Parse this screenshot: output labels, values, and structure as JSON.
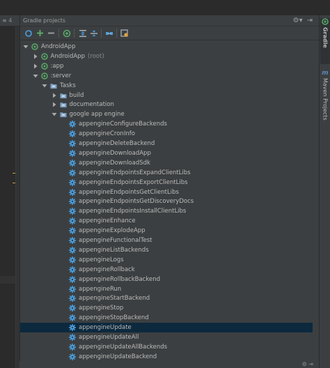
{
  "editor": {
    "tab_marker": "≡ 4"
  },
  "panel": {
    "title": "Gradle projects",
    "title_icons": [
      "gear-icon",
      "close-icon"
    ]
  },
  "toolbar": {
    "buttons": [
      "refresh-icon",
      "add-icon",
      "remove-icon",
      "execute-icon",
      "expand-all-icon",
      "collapse-all-icon",
      "link-icon",
      "settings-icon"
    ]
  },
  "tree": [
    {
      "label": "AndroidApp",
      "expanded": true,
      "icon": "gradle-icon"
    },
    {
      "label": "AndroidApp",
      "suffix": "(root)",
      "expanded": false,
      "icon": "gradle-icon"
    },
    {
      "label": ":app",
      "expanded": false,
      "icon": "gradle-icon"
    },
    {
      "label": ":server",
      "expanded": true,
      "icon": "gradle-icon"
    },
    {
      "label": "Tasks",
      "expanded": true,
      "icon": "folder-icon"
    },
    {
      "label": "build",
      "expanded": false,
      "icon": "folder-icon"
    },
    {
      "label": "documentation",
      "expanded": false,
      "icon": "folder-icon"
    },
    {
      "label": "google app engine",
      "expanded": true,
      "icon": "folder-icon"
    },
    {
      "label": "appengineConfigureBackends",
      "icon": "task-gear-icon"
    },
    {
      "label": "appengineCronInfo",
      "icon": "task-gear-icon"
    },
    {
      "label": "appengineDeleteBackend",
      "icon": "task-gear-icon"
    },
    {
      "label": "appengineDownloadApp",
      "icon": "task-gear-icon"
    },
    {
      "label": "appengineDownloadSdk",
      "icon": "task-gear-icon"
    },
    {
      "label": "appengineEndpointsExpandClientLibs",
      "icon": "task-gear-icon"
    },
    {
      "label": "appengineEndpointsExportClientLibs",
      "icon": "task-gear-icon"
    },
    {
      "label": "appengineEndpointsGetClientLibs",
      "icon": "task-gear-icon"
    },
    {
      "label": "appengineEndpointsGetDiscoveryDocs",
      "icon": "task-gear-icon"
    },
    {
      "label": "appengineEndpointsInstallClientLibs",
      "icon": "task-gear-icon"
    },
    {
      "label": "appengineEnhance",
      "icon": "task-gear-icon"
    },
    {
      "label": "appengineExplodeApp",
      "icon": "task-gear-icon"
    },
    {
      "label": "appengineFunctionalTest",
      "icon": "task-gear-icon"
    },
    {
      "label": "appengineListBackends",
      "icon": "task-gear-icon"
    },
    {
      "label": "appengineLogs",
      "icon": "task-gear-icon"
    },
    {
      "label": "appengineRollback",
      "icon": "task-gear-icon"
    },
    {
      "label": "appengineRollbackBackend",
      "icon": "task-gear-icon"
    },
    {
      "label": "appengineRun",
      "icon": "task-gear-icon"
    },
    {
      "label": "appengineStartBackend",
      "icon": "task-gear-icon"
    },
    {
      "label": "appengineStop",
      "icon": "task-gear-icon"
    },
    {
      "label": "appengineStopBackend",
      "icon": "task-gear-icon"
    },
    {
      "label": "appengineUpdate",
      "icon": "task-gear-icon",
      "selected": true
    },
    {
      "label": "appengineUpdateAll",
      "icon": "task-gear-icon"
    },
    {
      "label": "appengineUpdateAllBackends",
      "icon": "task-gear-icon"
    },
    {
      "label": "appengineUpdateBackend",
      "icon": "task-gear-icon"
    }
  ],
  "right_strip": {
    "tabs": [
      {
        "label": "Gradle",
        "icon": "gradle-icon",
        "active": true
      },
      {
        "label": "Maven Projects",
        "icon": "maven-icon",
        "active": false
      }
    ]
  },
  "colors": {
    "panel_bg": "#3c3f41",
    "selection": "#0d293e",
    "gear_blue": "#4a9fe0",
    "gradle_green": "#59a869",
    "folder_blue": "#7a9ec2"
  }
}
